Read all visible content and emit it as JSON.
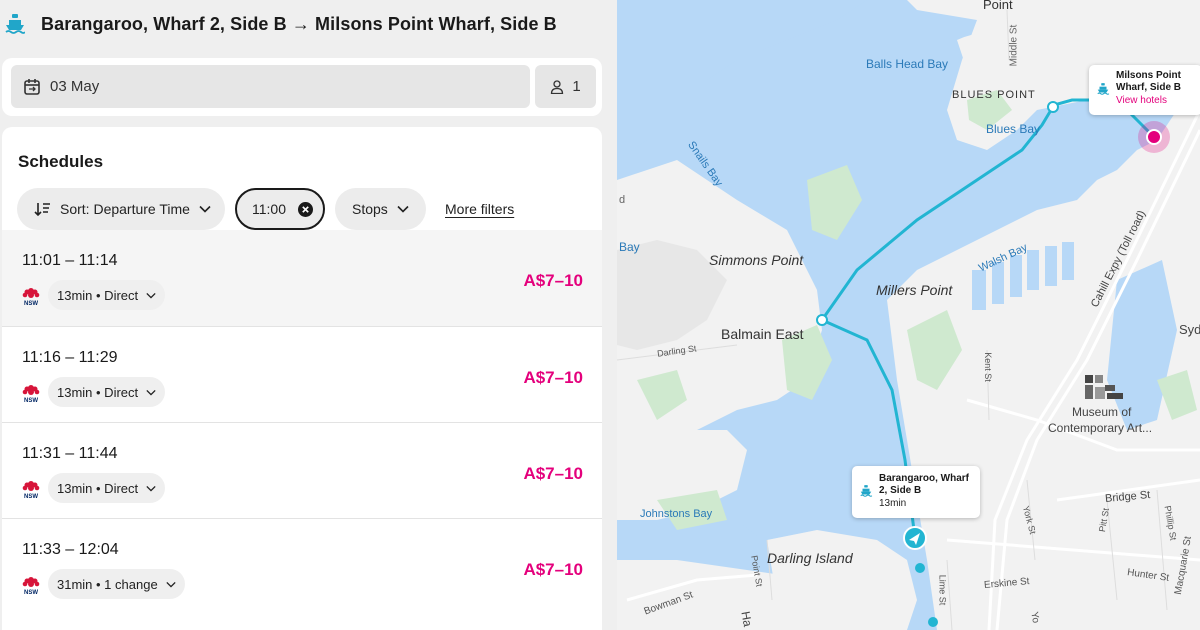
{
  "header": {
    "title": "Barangaroo, Wharf 2, Side B → Milsons Point Wharf, Side B",
    "mode_icon": "ferry-icon"
  },
  "search": {
    "date": "03 May",
    "passengers": "1"
  },
  "schedules": {
    "title": "Schedules",
    "filters": {
      "sort_label": "Sort: Departure Time",
      "time_label": "11:00",
      "stops_label": "Stops",
      "more_label": "More filters"
    },
    "rows": [
      {
        "times": "11:01 – 11:14",
        "detail": "13min • Direct",
        "price": "A$7–10"
      },
      {
        "times": "11:16 – 11:29",
        "detail": "13min • Direct",
        "price": "A$7–10"
      },
      {
        "times": "11:31 – 11:44",
        "detail": "13min • Direct",
        "price": "A$7–10"
      },
      {
        "times": "11:33 – 12:04",
        "detail": "31min • 1 change",
        "price": "A$7–10"
      }
    ],
    "operator_logo_text": "NSW"
  },
  "map": {
    "origin_callout": {
      "name": "Barangaroo, Wharf 2, Side B",
      "duration": "13min"
    },
    "destination_callout": {
      "name": "Milsons Point Wharf, Side B",
      "link": "View hotels"
    },
    "labels": {
      "point": "Point",
      "middle_st": "Middle St",
      "balls_head_bay": "Balls Head Bay",
      "blues_point": "BLUES POINT",
      "blues_bay": "Blues Bay",
      "snails_bay": "Snails Bay",
      "bay": "Bay",
      "simmons_point": "Simmons Point",
      "millers_point": "Millers Point",
      "walsh_bay": "Walsh Bay",
      "cahill_expy": "Cahill Expy (Toll road)",
      "syd": "Syd",
      "balmain_east": "Balmain East",
      "darling_st": "Darling St",
      "kent_st": "Kent St",
      "museum": "Museum of",
      "museum2": "Contemporary Art...",
      "johnstons_bay": "Johnstons Bay",
      "bridge_st": "Bridge St",
      "pitt_st": "Pitt St",
      "york_st": "York St",
      "phillip_st": "Phillip St",
      "macquarie_st": "Macquarie St",
      "hunter_st": "Hunter St",
      "erskine_st": "Erskine St",
      "darling_island": "Darling Island",
      "point_st": "Point St",
      "lime_st": "Lime St",
      "bowman_st": "Bowman St",
      "ha": "Ha",
      "yo": "Yo",
      "d": "d"
    },
    "colors": {
      "water": "#b7d8f7",
      "land": "#f2f2f2",
      "park": "#cfe9cf",
      "route": "#22b5d2",
      "accent": "#e4007c"
    }
  }
}
